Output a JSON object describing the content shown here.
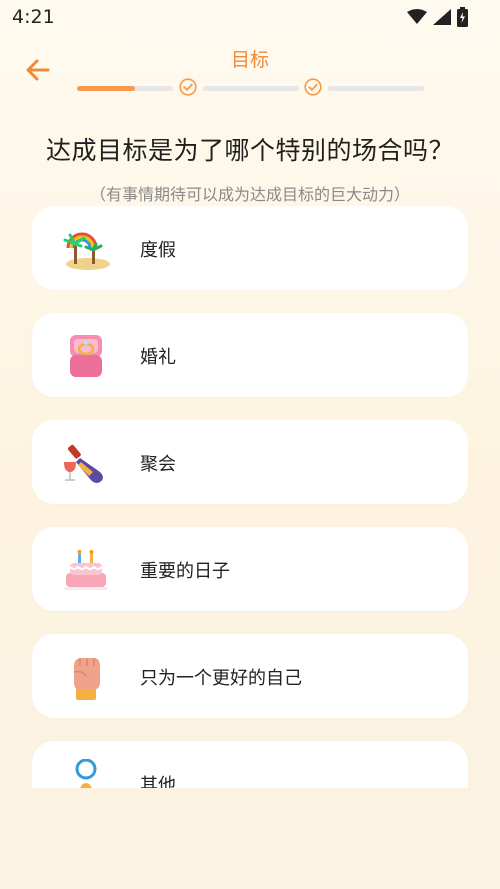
{
  "status_bar": {
    "time": "4:21"
  },
  "header": {
    "title": "目标",
    "progress_fraction": 0.43
  },
  "question": {
    "title": "达成目标是为了哪个特别的场合吗？",
    "subtitle": "（有事情期待可以成为达成目标的巨大动力）"
  },
  "options": [
    {
      "label": "度假",
      "icon": "island-icon"
    },
    {
      "label": "婚礼",
      "icon": "ring-box-icon"
    },
    {
      "label": "聚会",
      "icon": "wine-icon"
    },
    {
      "label": "重要的日子",
      "icon": "cake-icon"
    },
    {
      "label": "只为一个更好的自己",
      "icon": "fist-icon"
    },
    {
      "label": "其他",
      "icon": "medal-icon"
    }
  ],
  "colors": {
    "accent": "#f08a3a",
    "progress_fill": "#f49a4a",
    "track": "#e6e6e6"
  }
}
